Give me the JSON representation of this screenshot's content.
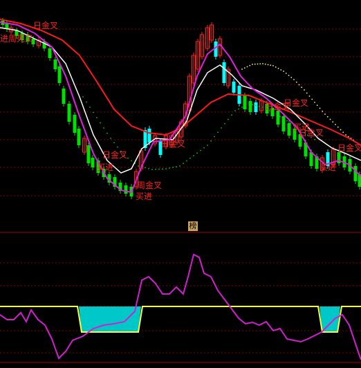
{
  "panel_divider": {
    "label": "榜"
  },
  "colors": {
    "background": "#000000",
    "grid": "#8b0000",
    "up_candle": "#ff2020",
    "down_candle": "#00ffff",
    "bear_candle": "#00e000",
    "ma_red": "#ff1a1a",
    "ma_white": "#ffffff",
    "ma_magenta": "#e020e0",
    "dots_green": "#00d000",
    "dots_yellow": "#ffff66",
    "signal_text": "#ff2020",
    "osc_line": "#d020d0",
    "osc_band": "#ffff33",
    "osc_fill": "#00c8c8"
  },
  "annotations": [
    {
      "text": "日金叉",
      "kind": "signal"
    },
    {
      "text": "周死叉",
      "kind": "signal"
    },
    {
      "text": "进",
      "kind": "signal"
    },
    {
      "text": "日金叉",
      "kind": "signal"
    },
    {
      "text": "买进",
      "kind": "signal"
    },
    {
      "text": "周金叉",
      "kind": "signal"
    },
    {
      "text": "买进",
      "kind": "signal"
    },
    {
      "text": "日金叉",
      "kind": "signal"
    },
    {
      "text": "日金叉",
      "kind": "signal"
    },
    {
      "text": "日金叉",
      "kind": "signal"
    },
    {
      "text": "买进",
      "kind": "signal"
    },
    {
      "text": "日金叉",
      "kind": "signal"
    },
    {
      "text": "日金叉",
      "kind": "signal"
    },
    {
      "text": "买进",
      "kind": "signal"
    }
  ],
  "chart_data": [
    {
      "type": "candlestick",
      "title": "",
      "series": [
        {
          "name": "",
          "style": "candles"
        },
        {
          "name": "",
          "style": "line",
          "color": "red"
        },
        {
          "name": "",
          "style": "line",
          "color": "white"
        },
        {
          "name": "",
          "style": "line",
          "color": "magenta"
        },
        {
          "name": "",
          "style": "dotted",
          "color": "green"
        },
        {
          "name": "",
          "style": "dotted",
          "color": "yellow"
        }
      ],
      "grid": true
    },
    {
      "type": "line",
      "title": "",
      "series": [
        {
          "name": "",
          "style": "line",
          "color": "magenta"
        },
        {
          "name": "",
          "style": "band",
          "color": "yellow"
        }
      ],
      "grid": true
    }
  ]
}
